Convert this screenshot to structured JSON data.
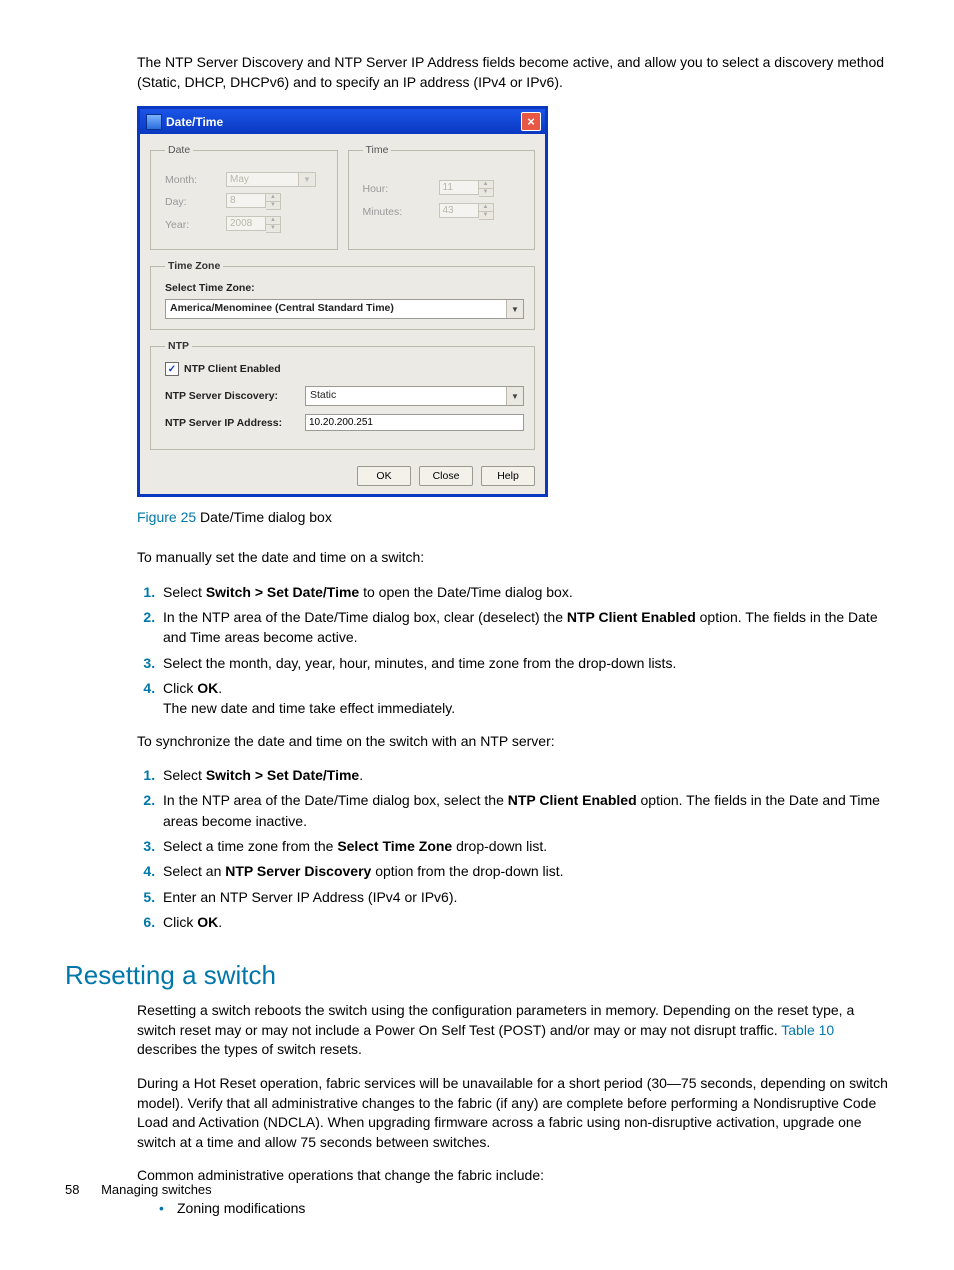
{
  "intro_text": "The NTP Server Discovery and NTP Server IP Address fields become active, and allow you to select a discovery method (Static, DHCP, DHCPv6) and to specify an IP address (IPv4 or IPv6).",
  "dialog": {
    "title": "Date/Time",
    "date": {
      "legend": "Date",
      "month_label": "Month:",
      "month_value": "May",
      "day_label": "Day:",
      "day_value": "8",
      "year_label": "Year:",
      "year_value": "2008"
    },
    "time": {
      "legend": "Time",
      "hour_label": "Hour:",
      "hour_value": "11",
      "minutes_label": "Minutes:",
      "minutes_value": "43"
    },
    "timezone": {
      "legend": "Time Zone",
      "label": "Select Time Zone:",
      "value": "America/Menominee (Central Standard Time)"
    },
    "ntp": {
      "legend": "NTP",
      "enabled_label": "NTP Client Enabled",
      "discovery_label": "NTP Server Discovery:",
      "discovery_value": "Static",
      "ip_label": "NTP Server IP Address:",
      "ip_value": "10.20.200.251"
    },
    "buttons": {
      "ok": "OK",
      "close": "Close",
      "help": "Help"
    }
  },
  "figure": {
    "label": "Figure 25",
    "caption": "  Date/Time dialog box"
  },
  "manual_intro": "To manually set the date and time on a switch:",
  "manual_steps": {
    "s1a": "Select ",
    "s1b": "Switch > Set Date/Time",
    "s1c": " to open the Date/Time dialog box.",
    "s2a": "In the NTP area of the Date/Time dialog box, clear (deselect) the ",
    "s2b": "NTP Client Enabled",
    "s2c": " option. The fields in the Date and Time areas become active.",
    "s3": "Select the month, day, year, hour, minutes, and time zone from the drop-down lists.",
    "s4a": "Click ",
    "s4b": "OK",
    "s4c": ".",
    "s4note": "The new date and time take effect immediately."
  },
  "sync_intro": "To synchronize the date and time on the switch with an NTP server:",
  "sync_steps": {
    "s1a": "Select ",
    "s1b": "Switch > Set Date/Time",
    "s1c": ".",
    "s2a": "In the NTP area of the Date/Time dialog box, select the ",
    "s2b": "NTP Client Enabled",
    "s2c": " option. The fields in the Date and Time areas become inactive.",
    "s3a": "Select a time zone from the ",
    "s3b": "Select Time Zone",
    "s3c": " drop-down list.",
    "s4a": "Select an ",
    "s4b": "NTP Server Discovery",
    "s4c": " option from the drop-down list.",
    "s5": "Enter an NTP Server IP Address (IPv4 or IPv6).",
    "s6a": "Click ",
    "s6b": "OK",
    "s6c": "."
  },
  "section_heading": "Resetting a switch",
  "reset_p1a": "Resetting a switch reboots the switch using the configuration parameters in memory. Depending on the reset type, a switch reset may or may not include a Power On Self Test (POST) and/or may or may not disrupt traffic. ",
  "reset_p1_link": "Table 10",
  "reset_p1b": " describes the types of switch resets.",
  "reset_p2": "During a Hot Reset operation, fabric services will be unavailable for a short period (30—75 seconds, depending on switch model). Verify that all administrative changes to the fabric (if any) are complete before performing a Nondisruptive Code Load and Activation (NDCLA). When upgrading firmware across a fabric using non-disruptive activation, upgrade one switch at a time and allow 75 seconds between switches.",
  "reset_p3": "Common administrative operations that change the fabric include:",
  "bullet1": "Zoning modifications",
  "footer": {
    "page": "58",
    "section": "Managing switches"
  }
}
